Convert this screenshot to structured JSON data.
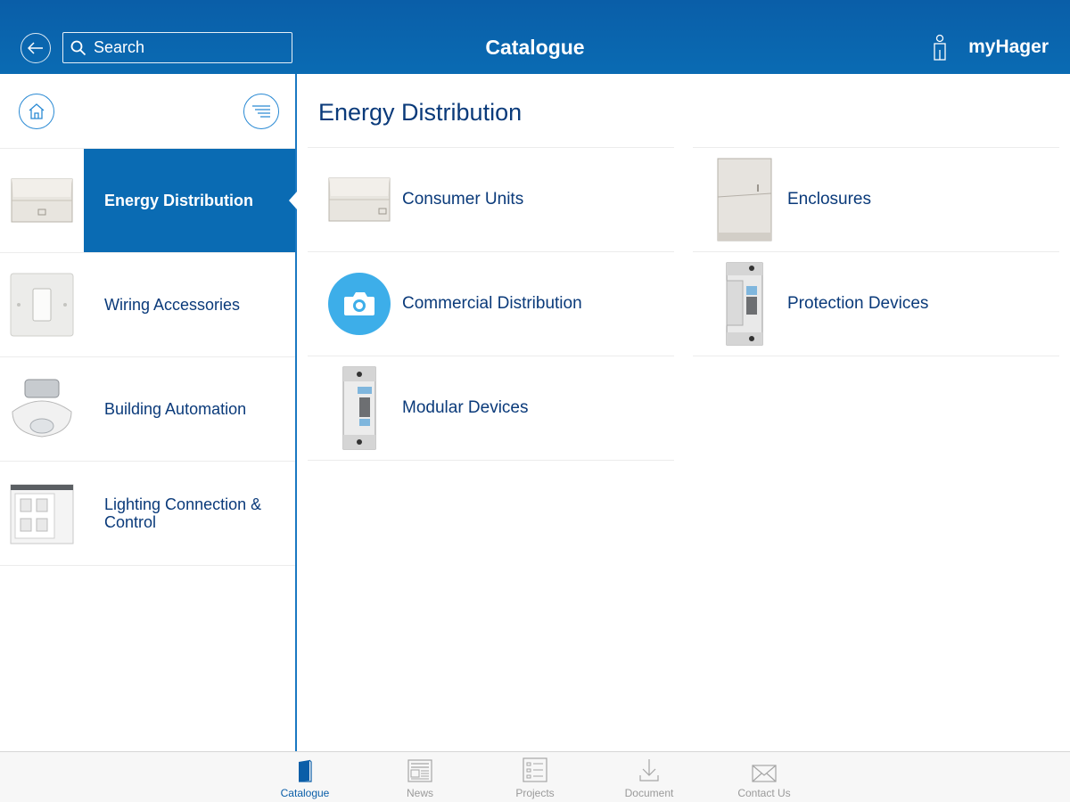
{
  "header": {
    "title": "Catalogue",
    "search_placeholder": "Search",
    "user_label": "myHager"
  },
  "sidebar": {
    "items": [
      {
        "label": "Energy Distribution",
        "active": true
      },
      {
        "label": "Wiring Accessories",
        "active": false
      },
      {
        "label": "Building Automation",
        "active": false
      },
      {
        "label": "Lighting Connection & Control",
        "active": false
      }
    ]
  },
  "main": {
    "title": "Energy Distribution",
    "items": [
      {
        "label": "Consumer Units",
        "icon": "consumer-unit-image"
      },
      {
        "label": "Enclosures",
        "icon": "enclosure-image"
      },
      {
        "label": "Commercial Distribution",
        "icon": "camera-placeholder-icon"
      },
      {
        "label": "Protection Devices",
        "icon": "circuit-breaker-image"
      },
      {
        "label": "Modular Devices",
        "icon": "modular-switch-image"
      }
    ]
  },
  "tabbar": {
    "tabs": [
      {
        "label": "Catalogue",
        "active": true,
        "icon": "book-icon"
      },
      {
        "label": "News",
        "active": false,
        "icon": "newspaper-icon"
      },
      {
        "label": "Projects",
        "active": false,
        "icon": "checklist-icon"
      },
      {
        "label": "Document",
        "active": false,
        "icon": "download-icon"
      },
      {
        "label": "Contact Us",
        "active": false,
        "icon": "envelope-icon"
      }
    ]
  },
  "colors": {
    "brand_blue": "#0a6bb3",
    "text_navy": "#0a3a7a",
    "camera_blue": "#3daee9"
  }
}
